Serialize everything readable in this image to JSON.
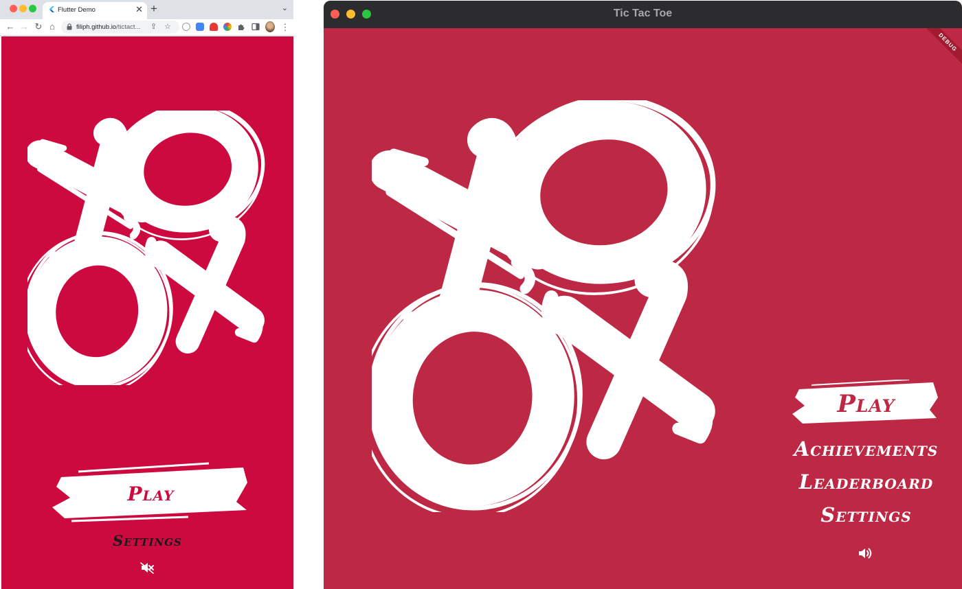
{
  "browser": {
    "tab_title": "Flutter Demo",
    "tab_close": "✕",
    "new_tab": "+",
    "tab_dropdown": "⌄",
    "url_host": "filiph.github.io",
    "url_path": "/tictact...",
    "nav": {
      "back": "←",
      "forward": "→",
      "reload": "↻",
      "home": "⌂",
      "share": "⇪",
      "bookmark": "☆",
      "menu": "⋮"
    }
  },
  "app_web": {
    "play_label": "Play",
    "settings_label": "Settings",
    "sound_state": "muted",
    "background_color": "#cd0a40"
  },
  "mac_window": {
    "title": "Tic Tac Toe",
    "debug_banner": "DEBUG",
    "background_color": "#bd2944"
  },
  "app_desktop": {
    "play_label": "Play",
    "achievements_label": "Achievements",
    "leaderboard_label": "Leaderboard",
    "settings_label": "Settings",
    "sound_state": "on"
  }
}
